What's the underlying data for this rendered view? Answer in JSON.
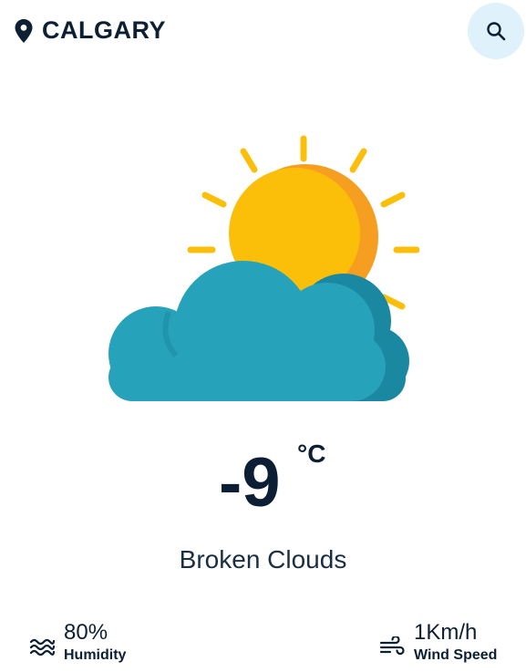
{
  "location": {
    "icon": "map-pin-icon",
    "city": "CALGARY"
  },
  "search": {
    "icon": "search-icon"
  },
  "weather": {
    "icon": "sun-behind-cloud-icon",
    "temperature": "-9",
    "unit": "°C",
    "condition": "Broken Clouds"
  },
  "stats": {
    "humidity": {
      "icon": "humidity-waves-icon",
      "value": "80%",
      "label": "Humidity"
    },
    "wind": {
      "icon": "wind-icon",
      "value": "1Km/h",
      "label": "Wind Speed"
    }
  },
  "colors": {
    "text": "#0d1f33",
    "search_bg": "#dff1fa",
    "sun": "#fbbf0a",
    "sun_shade": "#f59e1f",
    "cloud": "#27a2bb",
    "cloud_shade": "#1b88a2"
  }
}
